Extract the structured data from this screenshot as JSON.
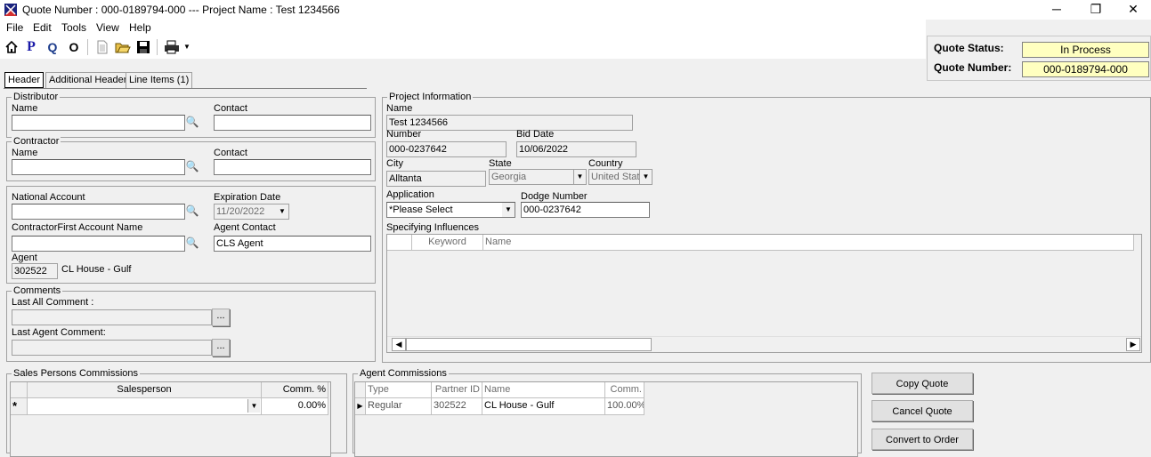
{
  "window": {
    "title": "Quote Number : 000-0189794-000 --- Project Name : Test 1234566",
    "minimize": "─",
    "restore": "❐",
    "close": "✕"
  },
  "menu": [
    "File",
    "Edit",
    "Tools",
    "View",
    "Help"
  ],
  "toolbar": {
    "p": "P",
    "q": "Q",
    "o": "O"
  },
  "status": {
    "quote_status_label": "Quote Status:",
    "quote_status_value": "In Process",
    "quote_number_label": "Quote Number:",
    "quote_number_value": "000-0189794-000"
  },
  "tabs": [
    "Header",
    "Additional Header",
    "Line Items (1)"
  ],
  "distributor": {
    "group": "Distributor",
    "name_label": "Name",
    "name": "",
    "contact_label": "Contact",
    "contact": ""
  },
  "contractor": {
    "group": "Contractor",
    "name_label": "Name",
    "name": "",
    "contact_label": "Contact",
    "contact": ""
  },
  "account": {
    "national_label": "National Account",
    "national": "",
    "expiration_label": "Expiration Date",
    "expiration": "11/20/2022",
    "cf_label": "ContractorFirst Account Name",
    "cf": "",
    "agent_contact_label": "Agent Contact",
    "agent_contact": "CLS Agent",
    "agent_label": "Agent",
    "agent_id": "302522",
    "agent_name": "CL House - Gulf"
  },
  "comments": {
    "group": "Comments",
    "last_all_label": "Last All Comment :",
    "last_agent_label": "Last Agent Comment:",
    "ellipsis": "..."
  },
  "project": {
    "group": "Project Information",
    "name_label": "Name",
    "name": "Test 1234566",
    "number_label": "Number",
    "number": "000-0237642",
    "bid_label": "Bid Date",
    "bid": "10/06/2022",
    "city_label": "City",
    "city": "Alltanta",
    "state_label": "State",
    "state": "Georgia",
    "country_label": "Country",
    "country": "United States",
    "application_label": "Application",
    "application": "*Please Select",
    "dodge_label": "Dodge Number",
    "dodge": "000-0237642",
    "influences_label": "Specifying Influences",
    "influences_cols": [
      "Keyword",
      "Name"
    ]
  },
  "sales": {
    "group": "Sales Persons Commissions",
    "cols": [
      "Salesperson",
      "Comm. %"
    ],
    "new_row_marker": "*",
    "comm": "0.00%"
  },
  "agent_comm": {
    "group": "Agent Commissions",
    "cols": [
      "Type",
      "Partner ID",
      "Name",
      "Comm."
    ],
    "rows": [
      {
        "type": "Regular",
        "partner_id": "302522",
        "name": "CL House - Gulf",
        "comm": "100.00%"
      }
    ]
  },
  "buttons": {
    "copy": "Copy Quote",
    "cancel": "Cancel Quote",
    "convert": "Convert to Order"
  }
}
